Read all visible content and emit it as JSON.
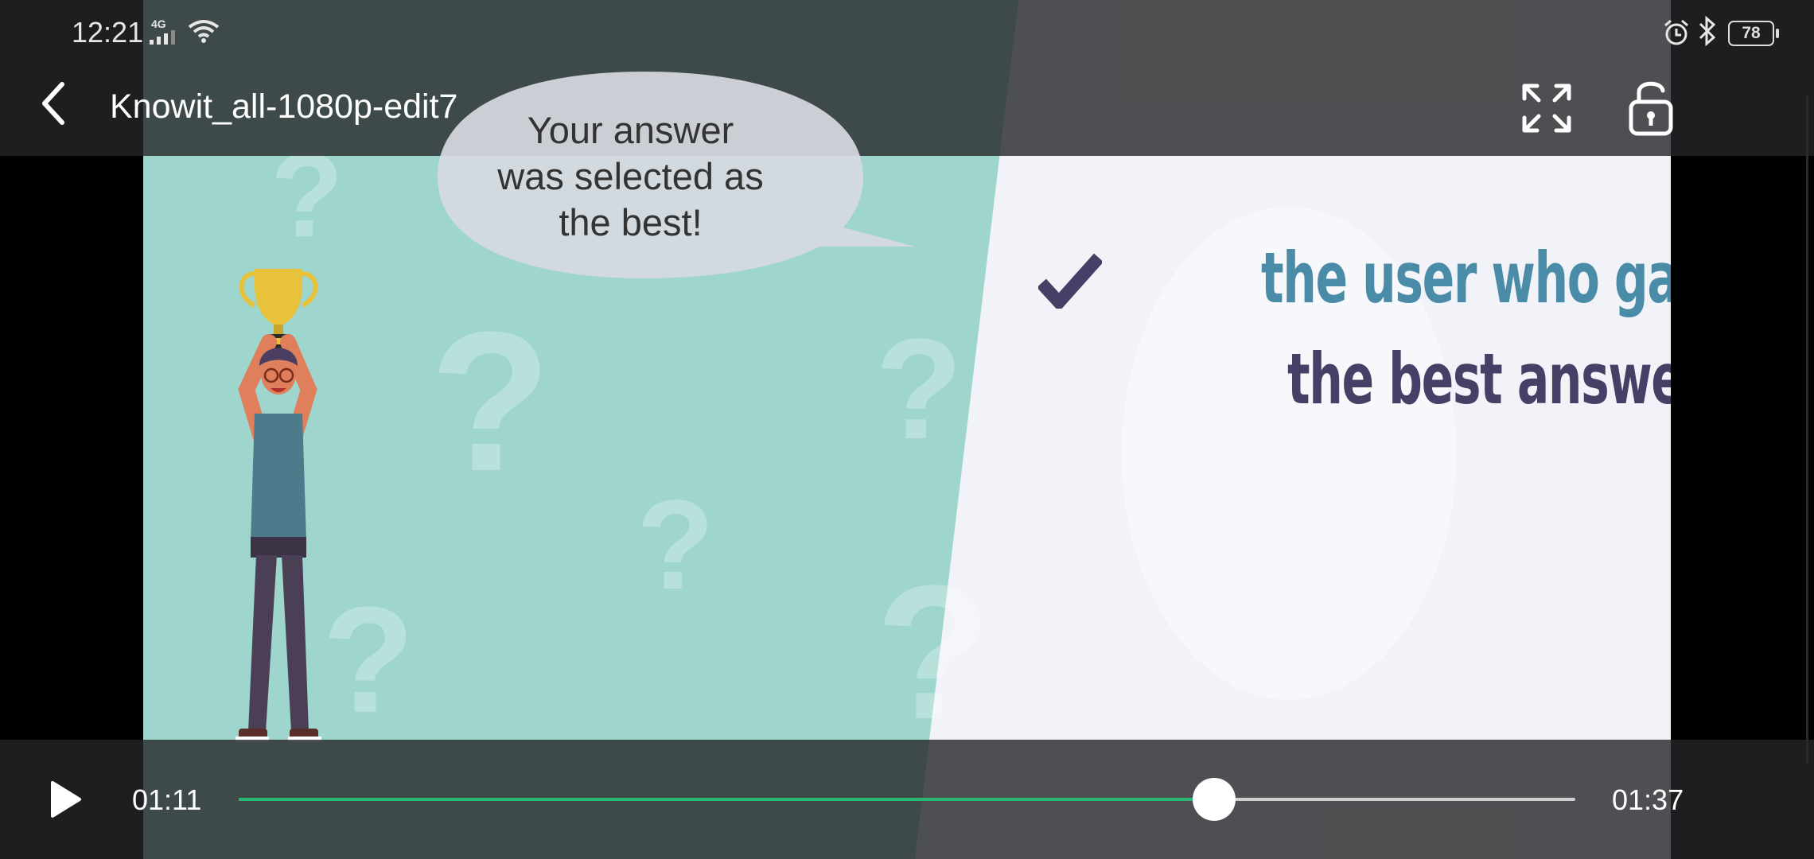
{
  "status_bar": {
    "time": "12:21",
    "network": "4G",
    "battery": "78",
    "icons": [
      "signal-icon",
      "wifi-icon",
      "alarm-icon",
      "bluetooth-icon",
      "battery-icon"
    ]
  },
  "header": {
    "title": "Knowit_all-1080p-edit7",
    "back_icon": "back-arrow-icon",
    "fullscreen_icon": "fullscreen-icon",
    "lock_icon": "unlock-icon"
  },
  "video": {
    "bubble_text": "Your answer\nwas selected as\nthe best!",
    "heading_line1": "the user who gave",
    "heading_line2": "the best answer",
    "colors": {
      "teal_bg": "#9ed6cd",
      "light_bg": "#f1f3f8",
      "heading_blue": "#4a8ca8",
      "heading_dark": "#463f66"
    }
  },
  "controls": {
    "play_icon": "play-icon",
    "current_time": "01:11",
    "total_time": "01:37",
    "progress_fraction": 0.73,
    "progress_color": "#2bb673"
  }
}
